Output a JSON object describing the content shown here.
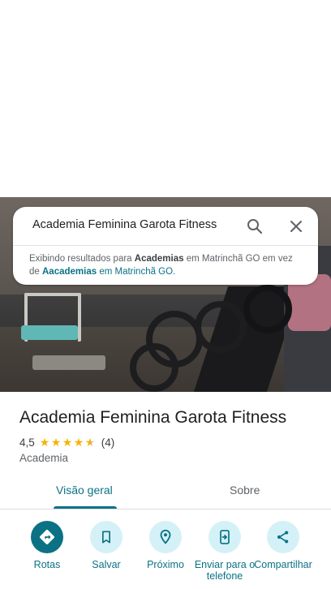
{
  "search": {
    "query": "Academia Feminina Garota Fitness",
    "correction": {
      "prefix": "Exibindo resultados para ",
      "shown_term": "Academias",
      "shown_suffix": " em Matrinchã GO em vez de ",
      "original_term": "Aacademias",
      "original_suffix": " em Matrinchã GO."
    }
  },
  "place": {
    "name": "Academia Feminina Garota Fitness",
    "rating": "4,5",
    "review_count": "(4)",
    "stars": 4.5,
    "category": "Academia"
  },
  "tabs": [
    {
      "label": "Visão geral",
      "active": true
    },
    {
      "label": "Sobre",
      "active": false
    }
  ],
  "actions": [
    {
      "label": "Rotas",
      "icon": "directions-icon"
    },
    {
      "label": "Salvar",
      "icon": "bookmark-icon"
    },
    {
      "label": "Próximo",
      "icon": "nearby-icon"
    },
    {
      "label": "Enviar para o telefone",
      "icon": "send-to-phone-icon"
    },
    {
      "label": "Compartilhar",
      "icon": "share-icon"
    }
  ],
  "colors": {
    "accent": "#0b7285",
    "action_bg": "#d4f1f7",
    "star": "#f4b400"
  }
}
